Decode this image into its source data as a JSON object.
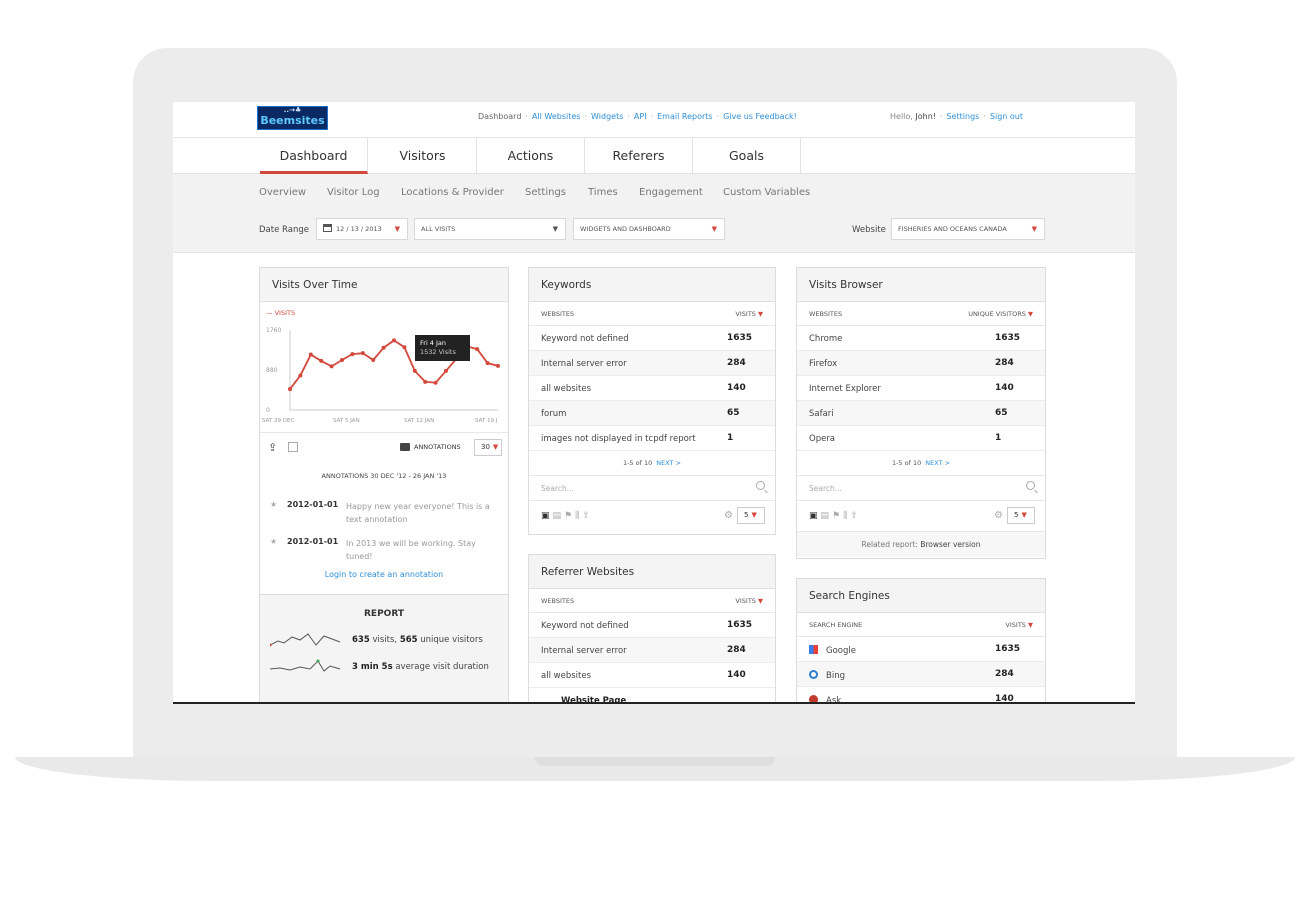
{
  "app": {
    "logo_text": "Beemsites",
    "logo_birds": "..→♣"
  },
  "toplinks": [
    "Dashboard",
    "All Websites",
    "Widgets",
    "API",
    "Email Reports",
    "Give us Feedback!"
  ],
  "user": {
    "greeting": "Hello,",
    "name": "John!",
    "settings": "Settings",
    "signout": "Sign out"
  },
  "tabs": [
    "Dashboard",
    "Visitors",
    "Actions",
    "Referers",
    "Goals"
  ],
  "subnav": [
    "Overview",
    "Visitor Log",
    "Locations & Provider",
    "Settings",
    "Times",
    "Engagement",
    "Custom Variables"
  ],
  "filters": {
    "date_label": "Date Range",
    "date_value": "12 / 13 / 2013",
    "segment": "ALL VISITS",
    "view": "WIDGETS AND DASHBOARD",
    "website_label": "Website",
    "website_value": "FISHERIES AND OCEANS CANADA"
  },
  "visits_over_time": {
    "title": "Visits Over Time",
    "legend": "VISITS",
    "tooltip_date": "Fri 4 Jan",
    "tooltip_value": "1532 Visits",
    "annotations_label": "ANNOTATIONS",
    "period_value": "30",
    "annotations_title": "ANNOTATIONS 30 DEC '12 - 26 JAN '13",
    "annotations": [
      {
        "date": "2012-01-01",
        "text": "Happy new year everyone! This is a text annotation"
      },
      {
        "date": "2012-01-01",
        "text": "In 2013 we will be working. Stay tuned!"
      }
    ],
    "login_link": "Login to create an annotation",
    "report_title": "REPORT",
    "report_lines": [
      {
        "a": "635",
        "b": " visits, ",
        "c": "565",
        "d": " unique visitors"
      },
      {
        "a": "3 min 5s",
        "b": " average visit duration",
        "c": "",
        "d": ""
      }
    ]
  },
  "chart_data": {
    "type": "line",
    "title": "",
    "xlabel": "",
    "ylabel": "",
    "ylim": [
      0,
      1760
    ],
    "yticks": [
      "1760",
      "880",
      "0"
    ],
    "xticks": [
      "SAT 29 DEC",
      "SAT 5 JAN",
      "SAT 12 JAN",
      "SAT 19 J"
    ],
    "series": [
      {
        "name": "VISITS",
        "values": [
          460,
          760,
          1220,
          1080,
          960,
          1100,
          1230,
          1250,
          1100,
          1370,
          1532,
          1380,
          860,
          620,
          600,
          860,
          1130,
          1400,
          1340,
          1030,
          970
        ]
      }
    ]
  },
  "keywords": {
    "title": "Keywords",
    "col1": "WEBSITES",
    "col2": "VISITS",
    "rows": [
      {
        "label": "Keyword not defined",
        "value": "1635"
      },
      {
        "label": "Internal server error",
        "value": "284"
      },
      {
        "label": "all websites",
        "value": "140"
      },
      {
        "label": "forum",
        "value": "65"
      },
      {
        "label": "images not displayed in tcpdf report",
        "value": "1"
      }
    ],
    "pager": "1-5 of 10",
    "next": "NEXT >",
    "search_placeholder": "Search...",
    "limit": "5"
  },
  "referrer_websites": {
    "title": "Referrer Websites",
    "col1": "WEBSITES",
    "col2": "VISITS",
    "rows": [
      {
        "label": "Keyword not defined",
        "value": "1635"
      },
      {
        "label": "Internal server error",
        "value": "284"
      },
      {
        "label": "all websites",
        "value": "140"
      }
    ],
    "partial_row": "Website Page"
  },
  "visits_browser": {
    "title": "Visits Browser",
    "col1": "WEBSITES",
    "col2": "UNIQUE VISITORS",
    "rows": [
      {
        "label": "Chrome",
        "value": "1635"
      },
      {
        "label": "Firefox",
        "value": "284"
      },
      {
        "label": "Internet Explorer",
        "value": "140"
      },
      {
        "label": "Safari",
        "value": "65"
      },
      {
        "label": "Opera",
        "value": "1"
      }
    ],
    "pager": "1-5 of 10",
    "next": "NEXT >",
    "search_placeholder": "Search...",
    "limit": "5",
    "related_label": "Related report:",
    "related_link": "Browser version"
  },
  "search_engines": {
    "title": "Search Engines",
    "col1": "SEARCH ENGINE",
    "col2": "VISITS",
    "rows": [
      {
        "label": "Google",
        "value": "1635"
      },
      {
        "label": "Bing",
        "value": "284"
      },
      {
        "label": "Ask",
        "value": "140"
      }
    ]
  },
  "colors": {
    "accent": "#d4473b",
    "link": "#2f8fd8",
    "panel": "#f4f4f4"
  }
}
